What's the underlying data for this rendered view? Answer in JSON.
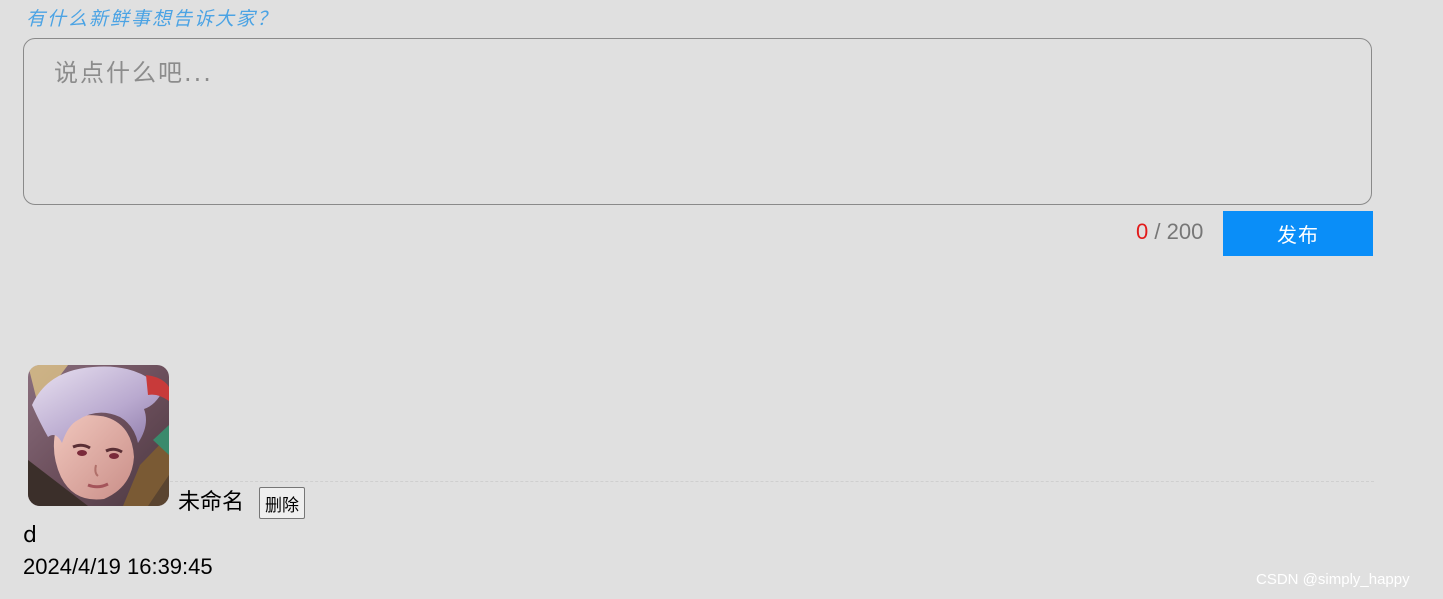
{
  "composer": {
    "prompt": "有什么新鲜事想告诉大家？",
    "placeholder": "说点什么吧...",
    "value": "",
    "char_count": "0",
    "char_separator": " / ",
    "char_limit": "200",
    "publish_label": "发布"
  },
  "posts": [
    {
      "avatar": "hero-portrait-avatar",
      "username": "未命名",
      "delete_label": "删除",
      "content": "d",
      "timestamp": "2024/4/19 16:39:45"
    }
  ],
  "watermark": "CSDN @simply_happy",
  "colors": {
    "background": "#e0e0e0",
    "accent": "#0a8ef8",
    "prompt_text": "#4ba3e4",
    "counter_current": "#e21b1b"
  }
}
